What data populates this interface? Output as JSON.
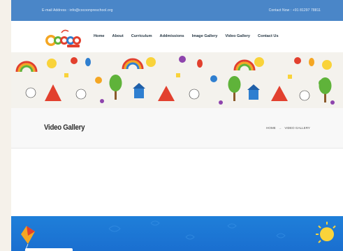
{
  "topbar": {
    "email": "E-mail Address : info@cocoonpreschool.org",
    "phone": "Contact Now : +91 81297 78811"
  },
  "logo": {
    "name": "COCOON",
    "tagline": "PRE SCHOOL"
  },
  "nav": {
    "items": [
      {
        "label": "Home"
      },
      {
        "label": "About"
      },
      {
        "label": "Curriculum"
      },
      {
        "label": "Addmissions"
      },
      {
        "label": "Image Gallery"
      },
      {
        "label": "Video Gallery"
      },
      {
        "label": "Contact Us"
      }
    ]
  },
  "page": {
    "title": "Video Gallery",
    "breadcrumb": {
      "home": "HOME",
      "separator": "→",
      "current": "VIDEO GALLERY"
    }
  },
  "colors": {
    "topbar": "#4a86c8",
    "footer": "#1f7fd9",
    "title_bg": "#f8f8f8"
  }
}
